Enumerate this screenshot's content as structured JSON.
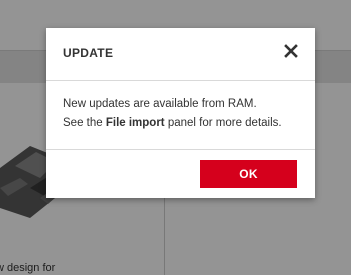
{
  "background": {
    "card_text": "w design for"
  },
  "dialog": {
    "title": "UPDATE",
    "close_icon": "close-icon",
    "body_line1": "New updates are available from RAM.",
    "body_line2_prefix": "See the ",
    "body_line2_bold": "File import",
    "body_line2_suffix": " panel for more details.",
    "ok_label": "OK"
  },
  "colors": {
    "accent": "#d5001c",
    "overlay": "rgba(0,0,0,0.42)",
    "text": "#333333"
  }
}
